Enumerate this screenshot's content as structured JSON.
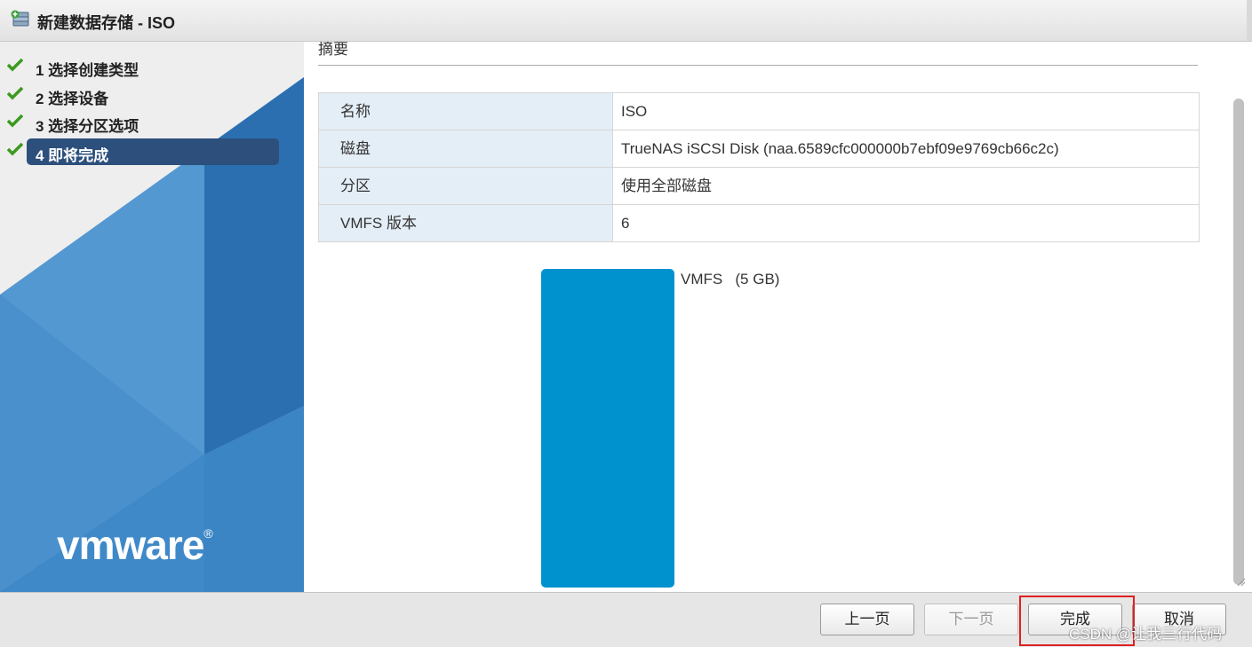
{
  "window": {
    "title": "新建数据存储 - ISO"
  },
  "wizard": {
    "steps": [
      {
        "label": "1 选择创建类型",
        "status": "completed"
      },
      {
        "label": "2 选择设备",
        "status": "completed"
      },
      {
        "label": "3 选择分区选项",
        "status": "completed"
      },
      {
        "label": "4 即将完成",
        "status": "active"
      }
    ],
    "logo": "vmware"
  },
  "main": {
    "section_title": "摘要",
    "summary": [
      {
        "key": "名称",
        "value": "ISO"
      },
      {
        "key": "磁盘",
        "value": "TrueNAS iSCSI Disk (naa.6589cfc000000b7ebf09e9769cb66c2c)"
      },
      {
        "key": "分区",
        "value": "使用全部磁盘"
      },
      {
        "key": "VMFS 版本",
        "value": "6"
      }
    ],
    "partition": {
      "label": "VMFS   (5 GB)",
      "color": "#0091cf"
    }
  },
  "footer": {
    "back_label": "上一页",
    "next_label": "下一页",
    "finish_label": "完成",
    "cancel_label": "取消"
  },
  "watermark": "CSDN @让我三行代码",
  "colors": {
    "accent": "#2d4f7c",
    "partition": "#0091cf",
    "highlight": "#e02020",
    "check": "#3c9a1f"
  }
}
